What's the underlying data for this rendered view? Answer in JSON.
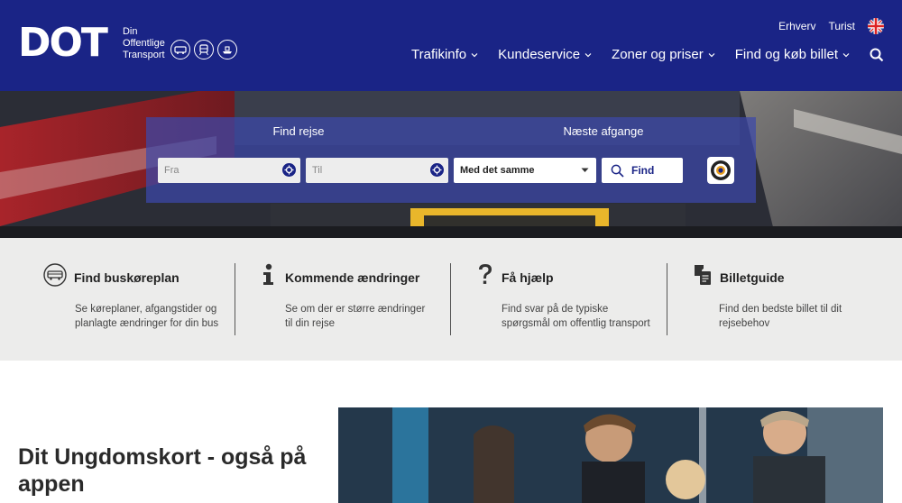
{
  "header": {
    "logo_mark": "DOT",
    "logo_lines": [
      "Din",
      "Offentlige",
      "Transport"
    ],
    "top_links": [
      "Erhverv",
      "Turist"
    ],
    "nav": [
      "Trafikinfo",
      "Kundeservice",
      "Zoner og priser",
      "Find og køb billet"
    ],
    "icons": [
      "bus-icon",
      "train-icon",
      "ferry-icon"
    ]
  },
  "search": {
    "tabs": [
      "Find rejse",
      "Næste afgange"
    ],
    "from_placeholder": "Fra",
    "to_placeholder": "Til",
    "time_option": "Med det samme",
    "find_label": "Find"
  },
  "quick_links": [
    {
      "title": "Find buskøreplan",
      "desc": "Se køreplaner, afgangstider og planlagte ændringer for din bus",
      "icon": "bus-icon"
    },
    {
      "title": "Kommende ændringer",
      "desc": "Se om der er større ændringer til din rejse",
      "icon": "info-icon"
    },
    {
      "title": "Få hjælp",
      "desc": "Find svar på de typiske spørgsmål om offentlig transport",
      "icon": "question-icon"
    },
    {
      "title": "Billetguide",
      "desc": "Find den bedste billet til dit rejsebehov",
      "icon": "ticket-icon"
    }
  ],
  "promo": {
    "title": "Dit Ungdomskort - også på appen"
  },
  "colors": {
    "brand": "#1a2486",
    "panel": "#ececeb"
  }
}
